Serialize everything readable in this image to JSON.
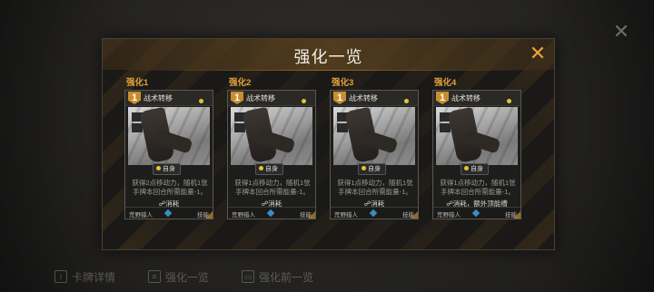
{
  "modal": {
    "title": "强化一览",
    "close_icon": "close-icon"
  },
  "cards": [
    {
      "label": "强化1",
      "cost": "1",
      "name": "战术转移",
      "tag": "自身",
      "desc": "获得2点移动力，随机1张手牌本回合所需能量-1。",
      "consume": "消耗",
      "class": "荒野猎人",
      "type": "技能"
    },
    {
      "label": "强化2",
      "cost": "1",
      "name": "战术转移",
      "tag": "自身",
      "desc": "获得1点移动力，随机1张手牌本回合所需能量-1。",
      "consume": "消耗",
      "class": "荒野猎人",
      "type": "技能"
    },
    {
      "label": "强化3",
      "cost": "1",
      "name": "战术转移",
      "tag": "自身",
      "desc": "获得1点移动力，随机1张手牌本回合所需能量-1。",
      "consume": "消耗",
      "class": "荒野猎人",
      "type": "技能"
    },
    {
      "label": "强化4",
      "cost": "1",
      "name": "战术转移",
      "tag": "自身",
      "desc": "获得1点移动力，随机1张手牌本回合所需能量-1。",
      "consume": "消耗，额外顶能槽",
      "class": "荒野猎人",
      "type": "技能"
    }
  ],
  "bottom_bar": {
    "items": [
      {
        "icon": "info-icon",
        "label": "卡牌详情"
      },
      {
        "icon": "list-icon",
        "label": "强化一览"
      },
      {
        "icon": "card-icon",
        "label": "强化前一览"
      }
    ]
  },
  "colors": {
    "accent": "#e1a33a",
    "energy": "#e3c433",
    "diamond": "#3a8ec0"
  }
}
